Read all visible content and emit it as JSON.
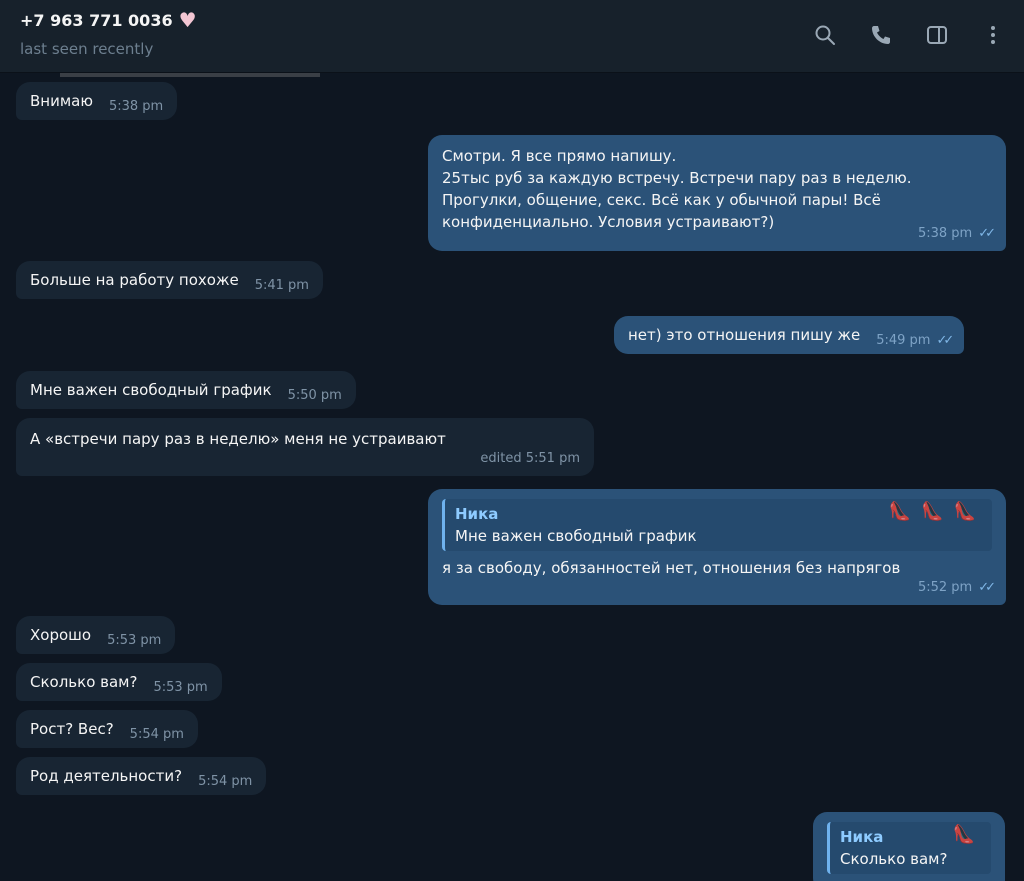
{
  "header": {
    "name": "+7 963 771 0036",
    "status": "last seen recently",
    "icons": [
      "search-icon",
      "phone-icon",
      "sidebar-icon",
      "more-icon"
    ]
  },
  "messages": [
    {
      "dir": "in",
      "text": "Внимаю",
      "time": "5:38 pm"
    },
    {
      "dir": "out",
      "text": "Смотри. Я все прямо напишу.\n25тыс руб за каждую встречу. Встречи пару раз в неделю.\nПрогулки, общение, секс. Всё как у обычной пары! Всё\nконфиденциально. Условия устраивают?)",
      "time": "5:38 pm"
    },
    {
      "dir": "in",
      "text": "Больше на работу похоже",
      "time": "5:41 pm"
    },
    {
      "dir": "out",
      "text": "нет) это отношения пишу же",
      "time": "5:49 pm"
    },
    {
      "dir": "in",
      "text": "Мне важен свободный график",
      "time": "5:50 pm"
    },
    {
      "dir": "in",
      "text": "А «встречи пару раз в неделю» меня не устраивают",
      "time": "edited 5:51 pm"
    },
    {
      "dir": "out",
      "reply_author": "Ника",
      "reply_text": "Мне важен свободный график",
      "text": "я за свободу, обязанностей нет, отношения без напрягов",
      "time": "5:52 pm"
    },
    {
      "dir": "in",
      "text": "Хорошо",
      "time": "5:53 pm"
    },
    {
      "dir": "in",
      "text": "Сколько вам?",
      "time": "5:53 pm"
    },
    {
      "dir": "in",
      "text": "Рост? Вес?",
      "time": "5:54 pm"
    },
    {
      "dir": "in",
      "text": "Род деятельности?",
      "time": "5:54 pm"
    },
    {
      "dir": "out",
      "reply_author": "Ника",
      "reply_text": "Сколько вам?"
    }
  ],
  "colors": {
    "background": "#0e1621",
    "incoming": "#182533",
    "outgoing": "#2b5278",
    "accent": "#6fb2ee"
  }
}
